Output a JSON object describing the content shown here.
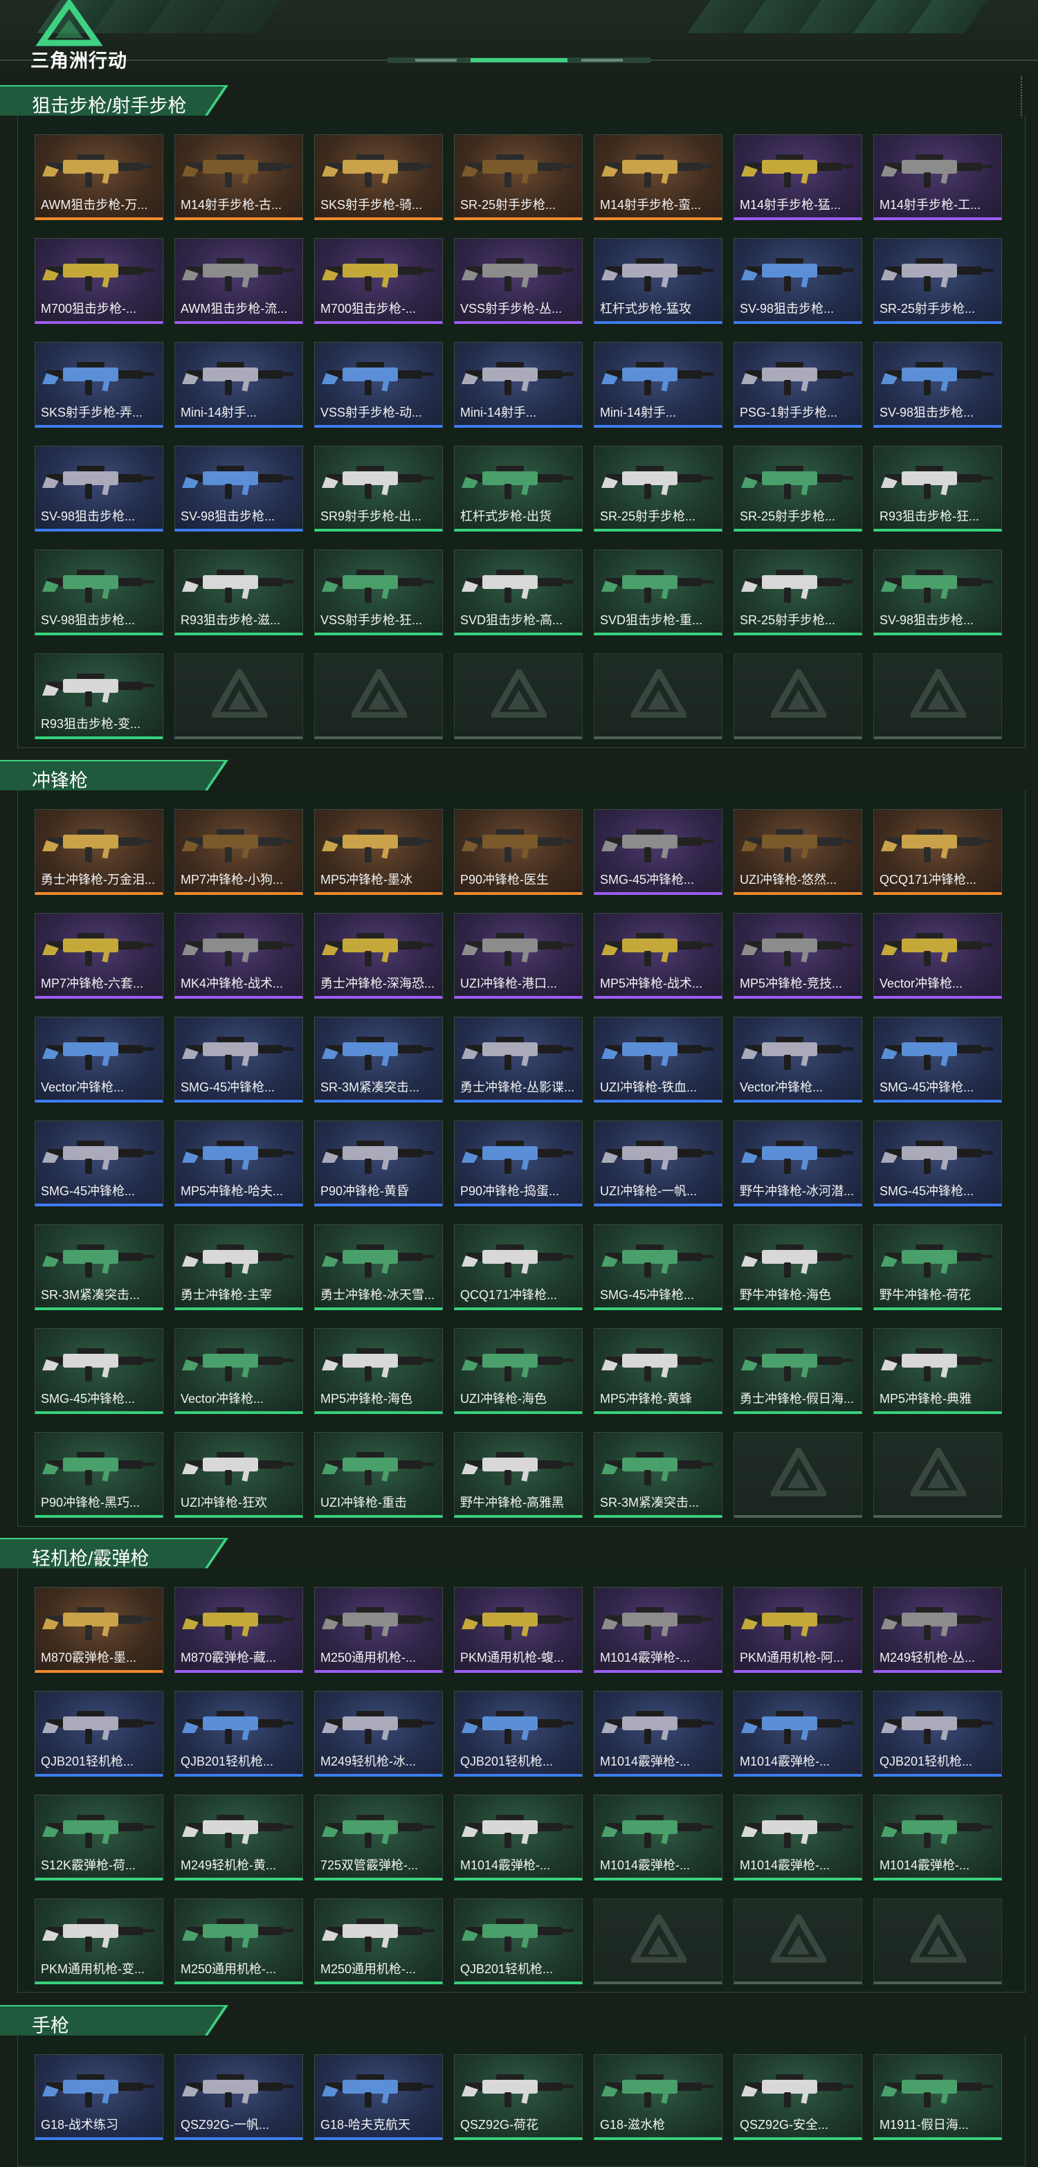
{
  "header": {
    "logo_text": "三角洲行动",
    "logo_icon": "delta-triangle-logo-icon"
  },
  "colors": {
    "orange": "#f08a2c",
    "purple": "#9b5cf5",
    "blue": "#3d7df2",
    "green": "#37d17c",
    "section_accent": "#2faa6a"
  },
  "sections": [
    {
      "title": "狙击步枪/射手步枪",
      "items": [
        {
          "name": "AWM狙击步枪-万...",
          "rarity": "orange"
        },
        {
          "name": "M14射手步枪-古...",
          "rarity": "orange"
        },
        {
          "name": "SKS射手步枪-骑...",
          "rarity": "orange"
        },
        {
          "name": "SR-25射手步枪...",
          "rarity": "orange"
        },
        {
          "name": "M14射手步枪-蛮...",
          "rarity": "orange"
        },
        {
          "name": "M14射手步枪-猛...",
          "rarity": "purple"
        },
        {
          "name": "M14射手步枪-工...",
          "rarity": "purple"
        },
        {
          "name": "M700狙击步枪-...",
          "rarity": "purple"
        },
        {
          "name": "AWM狙击步枪-流...",
          "rarity": "purple"
        },
        {
          "name": "M700狙击步枪-...",
          "rarity": "purple"
        },
        {
          "name": "VSS射手步枪-丛...",
          "rarity": "purple"
        },
        {
          "name": "杠杆式步枪-猛攻",
          "rarity": "blue"
        },
        {
          "name": "SV-98狙击步枪...",
          "rarity": "blue"
        },
        {
          "name": "SR-25射手步枪...",
          "rarity": "blue"
        },
        {
          "name": "SKS射手步枪-弄...",
          "rarity": "blue"
        },
        {
          "name": "Mini-14射手...",
          "rarity": "blue"
        },
        {
          "name": "VSS射手步枪-动...",
          "rarity": "blue"
        },
        {
          "name": "Mini-14射手...",
          "rarity": "blue"
        },
        {
          "name": "Mini-14射手...",
          "rarity": "blue"
        },
        {
          "name": "PSG-1射手步枪...",
          "rarity": "blue"
        },
        {
          "name": "SV-98狙击步枪...",
          "rarity": "blue"
        },
        {
          "name": "SV-98狙击步枪...",
          "rarity": "blue"
        },
        {
          "name": "SV-98狙击步枪...",
          "rarity": "blue"
        },
        {
          "name": "SR9射手步枪-出...",
          "rarity": "green"
        },
        {
          "name": "杠杆式步枪-出货",
          "rarity": "green"
        },
        {
          "name": "SR-25射手步枪...",
          "rarity": "green"
        },
        {
          "name": "SR-25射手步枪...",
          "rarity": "green"
        },
        {
          "name": "R93狙击步枪-狂...",
          "rarity": "green"
        },
        {
          "name": "SV-98狙击步枪...",
          "rarity": "green"
        },
        {
          "name": "R93狙击步枪-滋...",
          "rarity": "green"
        },
        {
          "name": "VSS射手步枪-狂...",
          "rarity": "green"
        },
        {
          "name": "SVD狙击步枪-高...",
          "rarity": "green"
        },
        {
          "name": "SVD狙击步枪-重...",
          "rarity": "green"
        },
        {
          "name": "SR-25射手步枪...",
          "rarity": "green"
        },
        {
          "name": "SV-98狙击步枪...",
          "rarity": "green"
        },
        {
          "name": "R93狙击步枪-变...",
          "rarity": "green"
        }
      ]
    },
    {
      "title": "冲锋枪",
      "items": [
        {
          "name": "勇士冲锋枪-万金泪...",
          "rarity": "orange"
        },
        {
          "name": "MP7冲锋枪-小狗...",
          "rarity": "orange"
        },
        {
          "name": "MP5冲锋枪-墨冰",
          "rarity": "orange"
        },
        {
          "name": "P90冲锋枪-医生",
          "rarity": "orange"
        },
        {
          "name": "SMG-45冲锋枪...",
          "rarity": "purple"
        },
        {
          "name": "UZI冲锋枪-悠然...",
          "rarity": "orange"
        },
        {
          "name": "QCQ171冲锋枪...",
          "rarity": "orange"
        },
        {
          "name": "MP7冲锋枪-六套...",
          "rarity": "purple"
        },
        {
          "name": "MK4冲锋枪-战术...",
          "rarity": "purple"
        },
        {
          "name": "勇士冲锋枪-深海恐...",
          "rarity": "purple"
        },
        {
          "name": "UZI冲锋枪-港口...",
          "rarity": "purple"
        },
        {
          "name": "MP5冲锋枪-战术...",
          "rarity": "purple"
        },
        {
          "name": "MP5冲锋枪-竞技...",
          "rarity": "purple"
        },
        {
          "name": "Vector冲锋枪...",
          "rarity": "purple"
        },
        {
          "name": "Vector冲锋枪...",
          "rarity": "blue"
        },
        {
          "name": "SMG-45冲锋枪...",
          "rarity": "blue"
        },
        {
          "name": "SR-3M紧凑突击...",
          "rarity": "blue"
        },
        {
          "name": "勇士冲锋枪-丛影谍...",
          "rarity": "blue"
        },
        {
          "name": "UZI冲锋枪-铁血...",
          "rarity": "blue"
        },
        {
          "name": "Vector冲锋枪...",
          "rarity": "blue"
        },
        {
          "name": "SMG-45冲锋枪...",
          "rarity": "blue"
        },
        {
          "name": "SMG-45冲锋枪...",
          "rarity": "blue"
        },
        {
          "name": "MP5冲锋枪-哈夫...",
          "rarity": "blue"
        },
        {
          "name": "P90冲锋枪-黄昏",
          "rarity": "blue"
        },
        {
          "name": "P90冲锋枪-捣蛋...",
          "rarity": "blue"
        },
        {
          "name": "UZI冲锋枪-一帆...",
          "rarity": "blue"
        },
        {
          "name": "野牛冲锋枪-冰河潜...",
          "rarity": "blue"
        },
        {
          "name": "SMG-45冲锋枪...",
          "rarity": "blue"
        },
        {
          "name": "SR-3M紧凑突击...",
          "rarity": "green"
        },
        {
          "name": "勇士冲锋枪-主宰",
          "rarity": "green"
        },
        {
          "name": "勇士冲锋枪-冰天雪...",
          "rarity": "green"
        },
        {
          "name": "QCQ171冲锋枪...",
          "rarity": "green"
        },
        {
          "name": "SMG-45冲锋枪...",
          "rarity": "green"
        },
        {
          "name": "野牛冲锋枪-海色",
          "rarity": "green"
        },
        {
          "name": "野牛冲锋枪-荷花",
          "rarity": "green"
        },
        {
          "name": "SMG-45冲锋枪...",
          "rarity": "green"
        },
        {
          "name": "Vector冲锋枪...",
          "rarity": "green"
        },
        {
          "name": "MP5冲锋枪-海色",
          "rarity": "green"
        },
        {
          "name": "UZI冲锋枪-海色",
          "rarity": "green"
        },
        {
          "name": "MP5冲锋枪-黄蜂",
          "rarity": "green"
        },
        {
          "name": "勇士冲锋枪-假日海...",
          "rarity": "green"
        },
        {
          "name": "MP5冲锋枪-典雅",
          "rarity": "green"
        },
        {
          "name": "P90冲锋枪-黑巧...",
          "rarity": "green"
        },
        {
          "name": "UZI冲锋枪-狂欢",
          "rarity": "green"
        },
        {
          "name": "UZI冲锋枪-重击",
          "rarity": "green"
        },
        {
          "name": "野牛冲锋枪-高雅黑",
          "rarity": "green"
        },
        {
          "name": "SR-3M紧凑突击...",
          "rarity": "green"
        }
      ]
    },
    {
      "title": "轻机枪/霰弹枪",
      "items": [
        {
          "name": "M870霰弹枪-墨...",
          "rarity": "orange"
        },
        {
          "name": "M870霰弹枪-藏...",
          "rarity": "purple"
        },
        {
          "name": "M250通用机枪-...",
          "rarity": "purple"
        },
        {
          "name": "PKM通用机枪-蝮...",
          "rarity": "purple"
        },
        {
          "name": "M1014霰弹枪-...",
          "rarity": "purple"
        },
        {
          "name": "PKM通用机枪-阿...",
          "rarity": "purple"
        },
        {
          "name": "M249轻机枪-丛...",
          "rarity": "purple"
        },
        {
          "name": "QJB201轻机枪...",
          "rarity": "blue"
        },
        {
          "name": "QJB201轻机枪...",
          "rarity": "blue"
        },
        {
          "name": "M249轻机枪-冰...",
          "rarity": "blue"
        },
        {
          "name": "QJB201轻机枪...",
          "rarity": "blue"
        },
        {
          "name": "M1014霰弹枪-...",
          "rarity": "blue"
        },
        {
          "name": "M1014霰弹枪-...",
          "rarity": "blue"
        },
        {
          "name": "QJB201轻机枪...",
          "rarity": "blue"
        },
        {
          "name": "S12K霰弹枪-荷...",
          "rarity": "green"
        },
        {
          "name": "M249轻机枪-黄...",
          "rarity": "green"
        },
        {
          "name": "725双管霰弹枪-...",
          "rarity": "green"
        },
        {
          "name": "M1014霰弹枪-...",
          "rarity": "green"
        },
        {
          "name": "M1014霰弹枪-...",
          "rarity": "green"
        },
        {
          "name": "M1014霰弹枪-...",
          "rarity": "green"
        },
        {
          "name": "M1014霰弹枪-...",
          "rarity": "green"
        },
        {
          "name": "PKM通用机枪-变...",
          "rarity": "green"
        },
        {
          "name": "M250通用机枪-...",
          "rarity": "green"
        },
        {
          "name": "M250通用机枪-...",
          "rarity": "green"
        },
        {
          "name": "QJB201轻机枪...",
          "rarity": "green"
        }
      ]
    },
    {
      "title": "手枪",
      "items": [
        {
          "name": "G18-战术练习",
          "rarity": "blue"
        },
        {
          "name": "QSZ92G-一帆...",
          "rarity": "blue"
        },
        {
          "name": "G18-哈夫克航天",
          "rarity": "blue"
        },
        {
          "name": "QSZ92G-荷花",
          "rarity": "green"
        },
        {
          "name": "G18-滋水枪",
          "rarity": "green"
        },
        {
          "name": "QSZ92G-安全...",
          "rarity": "green"
        },
        {
          "name": "M1911-假日海...",
          "rarity": "green"
        }
      ]
    }
  ]
}
